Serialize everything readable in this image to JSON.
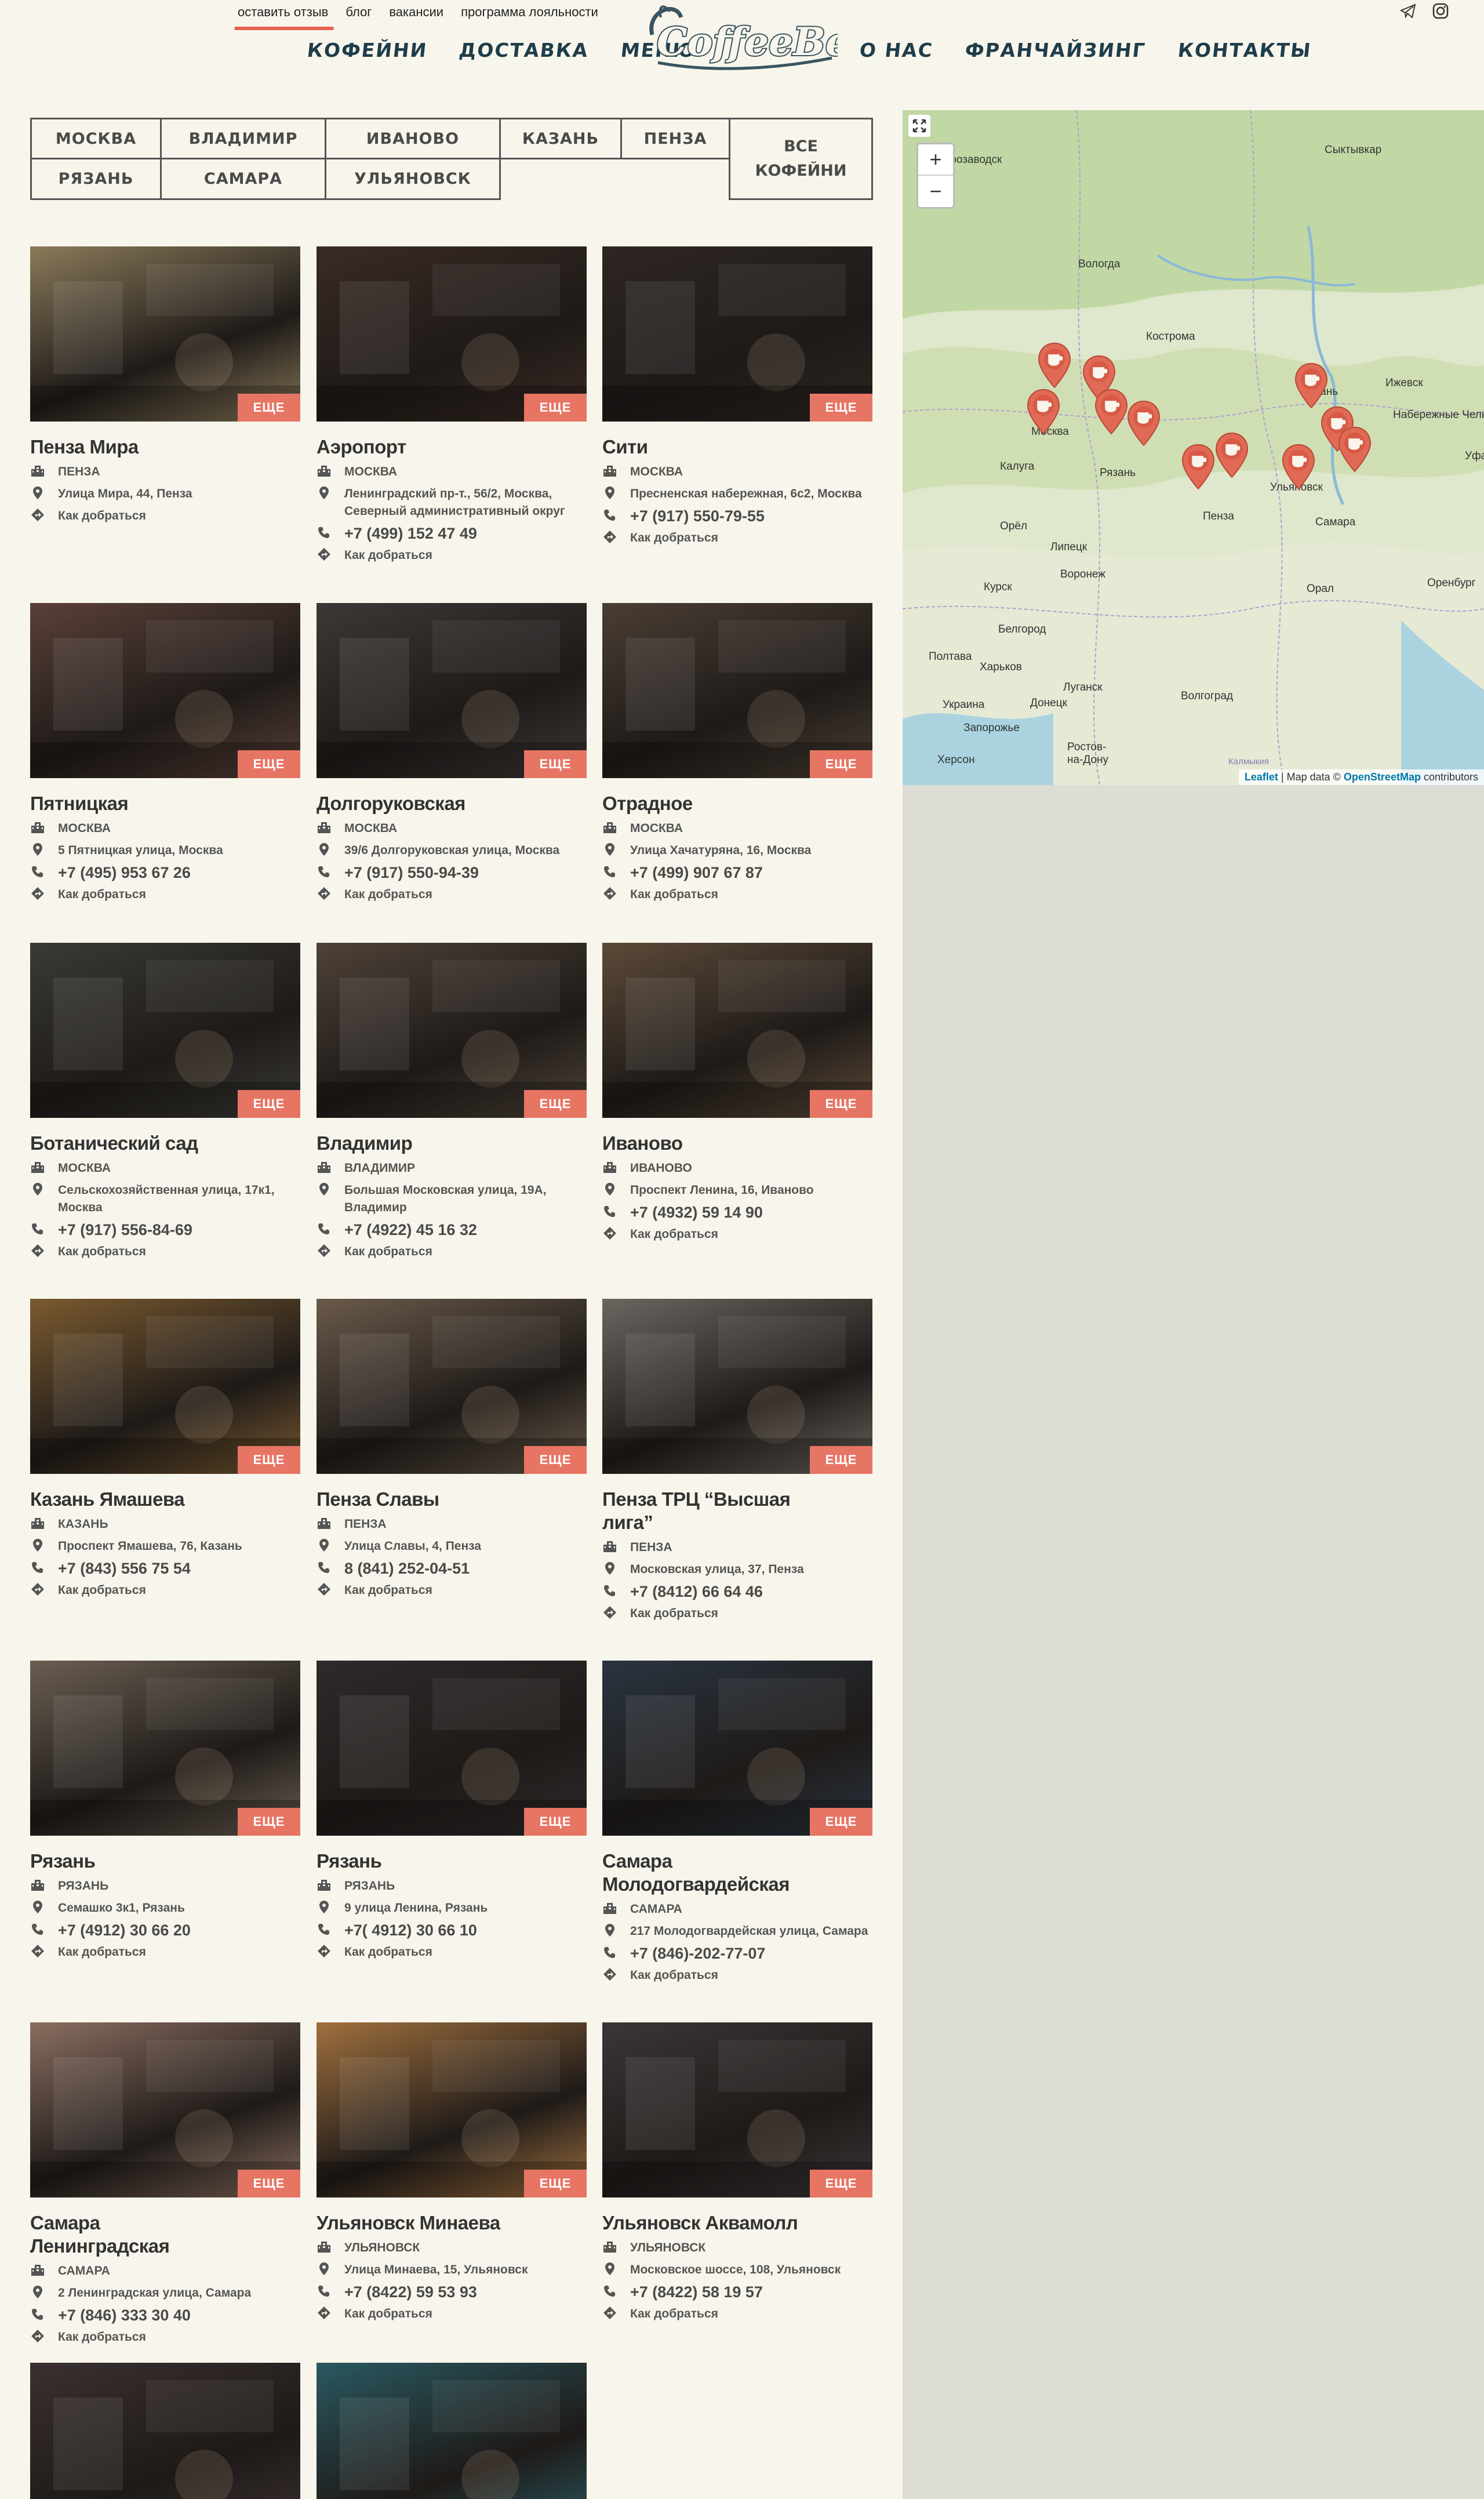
{
  "header": {
    "top_links": [
      "оставить отзыв",
      "блог",
      "вакансии",
      "программа лояльности"
    ],
    "nav_left": [
      "Кофейни",
      "Доставка",
      "Меню"
    ],
    "nav_right": [
      "О нас",
      "Франчайзинг",
      "Контакты"
    ],
    "logo_text": "CoffeeBean",
    "social_icons": [
      "telegram-icon",
      "instagram-icon"
    ]
  },
  "cities": {
    "row1": [
      "Москва",
      "Владимир",
      "Иваново",
      "Казань",
      "Пенза"
    ],
    "row2": [
      "Рязань",
      "Самара",
      "Ульяновск"
    ],
    "all": "Все кофейни"
  },
  "more_label": "ЕЩЕ",
  "directions_label": "Как добраться",
  "cafes": [
    {
      "name": "Пенза Мира",
      "city": "ПЕНЗА",
      "address": "Улица Мира, 44, Пенза",
      "phone": "",
      "photo": "#8a7a5a"
    },
    {
      "name": "Аэропорт",
      "city": "МОСКВА",
      "address": "Ленинградский пр-т., 56/2, Москва, Северный административный округ",
      "phone": "+7 (499) 152 47 49",
      "photo": "#3a2a24"
    },
    {
      "name": "Сити",
      "city": "МОСКВА",
      "address": "Пресненская набережная, 6с2, Москва",
      "phone": "+7 (917) 550-79-55",
      "photo": "#2e2622"
    },
    {
      "name": "Пятницкая",
      "city": "МОСКВА",
      "address": "5 Пятницкая улица, Москва",
      "phone": "+7 (495) 953 67 26",
      "photo": "#5a4038"
    },
    {
      "name": "Долгоруковская",
      "city": "МОСКВА",
      "address": "39/6 Долгоруковская улица, Москва",
      "phone": "+7 (917) 550-94-39",
      "photo": "#3c3836"
    },
    {
      "name": "Отрадное",
      "city": "МОСКВА",
      "address": "Улица Хачатуряна, 16, Москва",
      "phone": "+7 (499) 907 67 87",
      "photo": "#4a3e34"
    },
    {
      "name": "Ботанический сад",
      "city": "МОСКВА",
      "address": "Сельскохозяйственная улица, 17к1, Москва",
      "phone": "+7 (917) 556-84-69",
      "photo": "#3a3a34"
    },
    {
      "name": "Владимир",
      "city": "ВЛАДИМИР",
      "address": "Большая Московская улица, 19А, Владимир",
      "phone": "+7 (4922) 45 16 32",
      "photo": "#4e4238"
    },
    {
      "name": "Иваново",
      "city": "ИВАНОВО",
      "address": "Проспект Ленина, 16, Иваново",
      "phone": "+7 (4932) 59 14 90",
      "photo": "#5c4a38"
    },
    {
      "name": "Казань Ямашева",
      "city": "КАЗАНЬ",
      "address": "Проспект Ямашева, 76, Казань",
      "phone": "+7 (843) 556 75 54",
      "photo": "#7a5a30"
    },
    {
      "name": "Пенза Славы",
      "city": "ПЕНЗА",
      "address": "Улица Славы, 4, Пенза",
      "phone": "8 (841) 252-04-51",
      "photo": "#6a5a4a"
    },
    {
      "name": "Пенза ТРЦ “Высшая лига”",
      "city": "ПЕНЗА",
      "address": "Московская улица, 37, Пенза",
      "phone": "+7 (8412) 66 64 46",
      "photo": "#6a6660"
    },
    {
      "name": "Рязань",
      "city": "РЯЗАНЬ",
      "address": "Семашко 3к1, Рязань",
      "phone": "+7 (4912) 30 66 20",
      "photo": "#6a5e52"
    },
    {
      "name": "Рязань",
      "city": "РЯЗАНЬ",
      "address": "9 улица Ленина, Рязань",
      "phone": "+7( 4912) 30 66 10",
      "photo": "#2e2a2a"
    },
    {
      "name": "Самара Молодогвардейская",
      "city": "САМАРА",
      "address": "217 Молодогвардейская улица, Самара",
      "phone": "+7 (846)-202-77-07",
      "photo": "#2a3440"
    },
    {
      "name": "Самара Ленинградская",
      "city": "САМАРА",
      "address": "2 Ленинградская улица, Самара",
      "phone": "+7 (846) 333 30 40",
      "photo": "#8a6e60"
    },
    {
      "name": "Ульяновск Минаева",
      "city": "УЛЬЯНОВСК",
      "address": "Улица Минаева, 15, Ульяновск",
      "phone": "+7 (8422) 59 53 93",
      "photo": "#a0703e"
    },
    {
      "name": "Ульяновск Аквамолл",
      "city": "УЛЬЯНОВСК",
      "address": "Московское шоссе, 108, Ульяновск",
      "phone": "+7 (8422) 58 19 57",
      "photo": "#3a3636"
    },
    {
      "name": "",
      "city": "",
      "address": "",
      "phone": "",
      "photo": "#3a3030"
    },
    {
      "name": "",
      "city": "",
      "address": "",
      "phone": "",
      "photo": "#2a5860"
    }
  ],
  "map": {
    "attribution_leaflet": "Leaflet",
    "attribution_text": " | Map data © ",
    "attribution_osm": "OpenStreetMap",
    "attribution_tail": " contributors",
    "labels": [
      "Петрозаводск",
      "Сыктывкар",
      "Вологда",
      "Кострома",
      "Москва",
      "Казань",
      "Ижевск",
      "Набережные Челны",
      "Калуга",
      "Рязань",
      "Ульяновск",
      "Пенза",
      "Самара",
      "Орёл",
      "Липецк",
      "Воронеж",
      "Курск",
      "Белгород",
      "Харьков",
      "Полтава",
      "Луганск",
      "Донецк",
      "Волгоград",
      "Запорожье",
      "Ростов-на-Дону",
      "Херсон",
      "Оренбург",
      "Украина",
      "Уфа",
      "Орал",
      "Калмыкия",
      "Тула"
    ],
    "colors": {
      "marker": "#e06a55",
      "land": "#dfe7cc",
      "forest": "#b9d59a"
    }
  }
}
